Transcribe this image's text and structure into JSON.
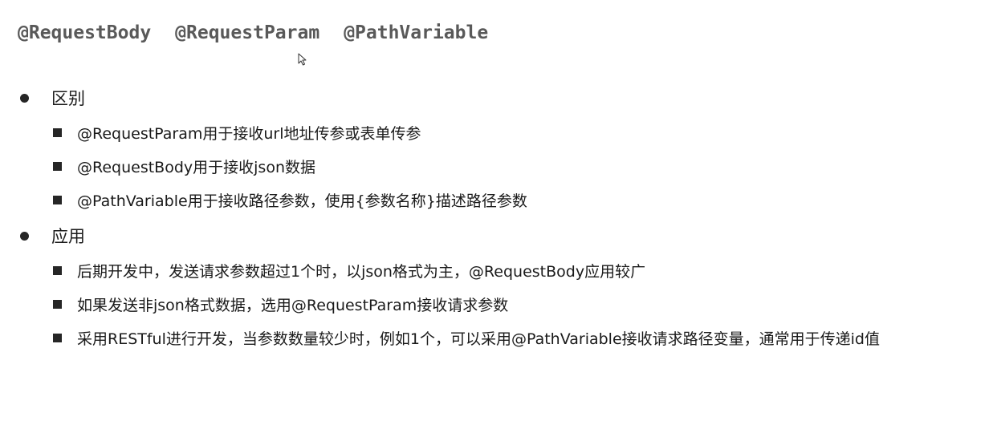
{
  "heading": {
    "annotations": [
      "@RequestBody",
      "@RequestParam",
      "@PathVariable"
    ]
  },
  "sections": [
    {
      "title": "区别",
      "items": [
        "@RequestParam用于接收url地址传参或表单传参",
        "@RequestBody用于接收json数据",
        "@PathVariable用于接收路径参数，使用{参数名称}描述路径参数"
      ]
    },
    {
      "title": "应用",
      "items": [
        "后期开发中，发送请求参数超过1个时，以json格式为主，@RequestBody应用较广",
        "如果发送非json格式数据，选用@RequestParam接收请求参数",
        "采用RESTful进行开发，当参数数量较少时，例如1个，可以采用@PathVariable接收请求路径变量，通常用于传递id值"
      ]
    }
  ],
  "colors": {
    "heading": "#595959",
    "text": "#1a1a1a",
    "bullet": "#262626"
  },
  "icons": {
    "cursor": "mouse-pointer-icon"
  }
}
